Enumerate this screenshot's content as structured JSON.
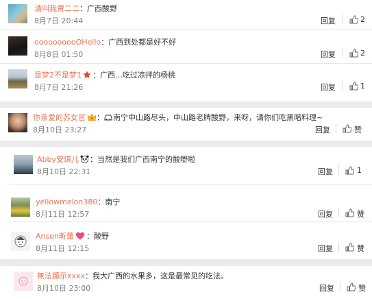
{
  "comments": [
    {
      "user": "请叫我贾二二",
      "text": "：广西酸野",
      "time": "8月7日 20:44",
      "reply": "回复",
      "likes": "2"
    },
    {
      "user": "oooooooooOHello",
      "text": "：广西到处都是好不好",
      "time": "8月8日 01:50",
      "reply": "回复",
      "likes": "2"
    },
    {
      "user": "是梦2不是梦1",
      "text": "：广西…吃过凉拌的杨桃",
      "time": "8月7日 21:26",
      "reply": "回复",
      "likes": "1"
    },
    {
      "user": "你亲爱的苏女官",
      "text": "：",
      "text2": "南宁中山路尽头，中山路老牌酸野，来呀，请你们吃黑暗料理~",
      "time": "8月10日 23:27",
      "reply": "回复",
      "likes": "赞"
    },
    {
      "user": "Abby安琪儿",
      "text": "：当然是我们广西南宁的酸嘢啦",
      "time": "8月10日 22:31",
      "reply": "回复",
      "likes": "1"
    },
    {
      "user": "yellowmelon380",
      "text": "：南宁",
      "time": "8月11日 12:57",
      "reply": "回复",
      "likes": "赞"
    },
    {
      "user": "Anson昕蕾",
      "text": "：酸野",
      "time": "8月11日 12:15",
      "reply": "回复",
      "likes": "赞"
    },
    {
      "user": "無法顯示xxxx",
      "text": "：我大广西的水果多，这是最常见的吃法。",
      "time": "8月10日 23:00",
      "reply": "回复",
      "likes": "赞"
    }
  ],
  "colors": {
    "username": "#eb7350",
    "time": "#808080",
    "background": "#ebebeb"
  }
}
